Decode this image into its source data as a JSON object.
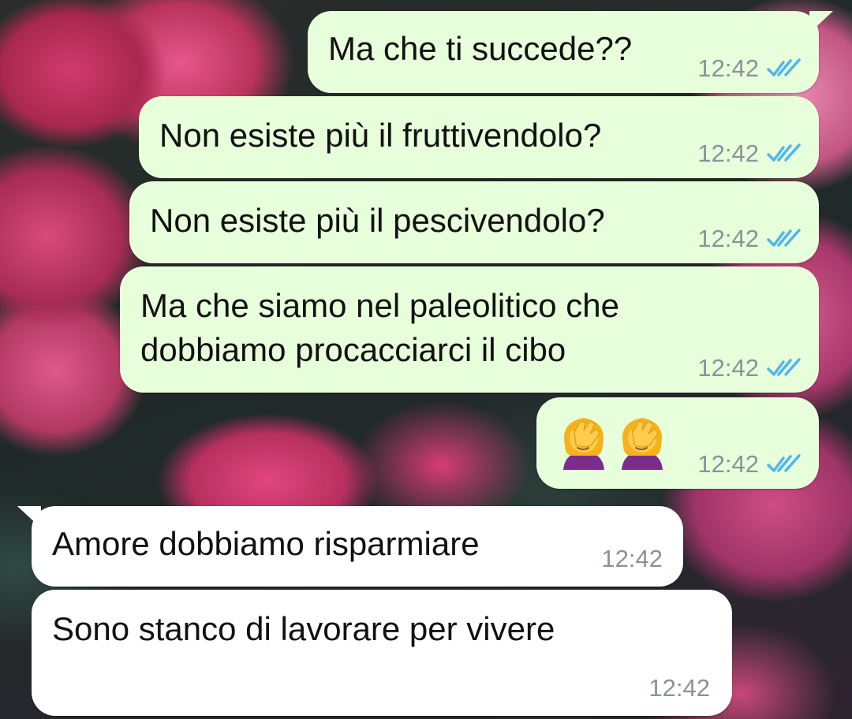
{
  "messages": [
    {
      "direction": "outgoing",
      "text": "Ma che ti succede??",
      "time": "12:42",
      "status": "read"
    },
    {
      "direction": "outgoing",
      "text": "Non esiste più il fruttivendolo?",
      "time": "12:42",
      "status": "read"
    },
    {
      "direction": "outgoing",
      "text": "Non esiste più il pescivendolo?",
      "time": "12:42",
      "status": "read"
    },
    {
      "direction": "outgoing",
      "text": "Ma che siamo nel paleolitico che\ndobbiamo procacciarci il cibo",
      "time": "12:42",
      "status": "read"
    },
    {
      "direction": "outgoing",
      "emoji": [
        "woman-facepalming-icon",
        "woman-facepalming-icon"
      ],
      "time": "12:42",
      "status": "read"
    },
    {
      "direction": "incoming",
      "text": "Amore dobbiamo risparmiare",
      "time": "12:42"
    },
    {
      "direction": "incoming",
      "text": "Sono stanco di lavorare per vivere",
      "time": "12:42"
    }
  ],
  "colors": {
    "outgoing_bubble": "#e7ffdb",
    "incoming_bubble": "#ffffff",
    "read_ticks": "#4fb6ec",
    "timestamp": "#8a9299"
  }
}
